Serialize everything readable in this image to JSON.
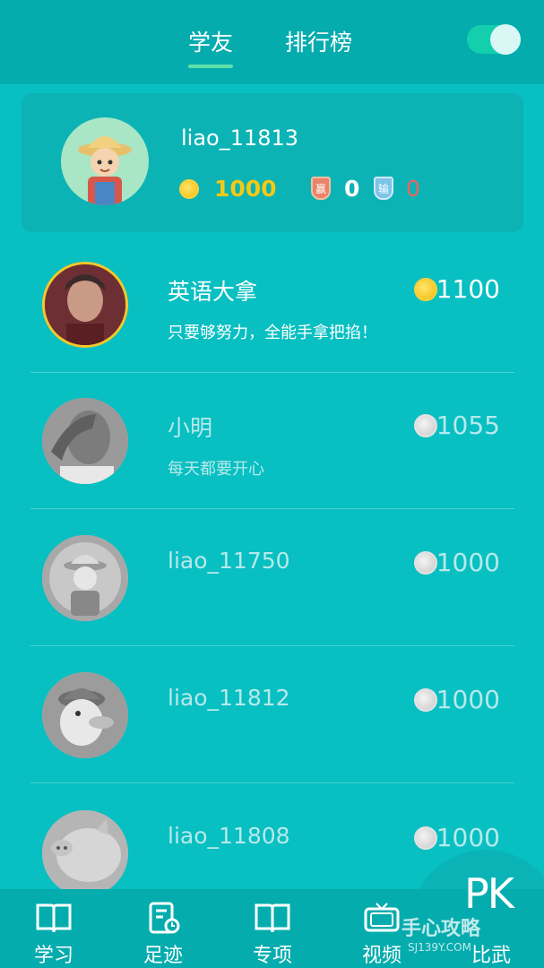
{
  "header": {
    "tabs": [
      {
        "label": "学友",
        "active": true
      },
      {
        "label": "排行榜",
        "active": false
      }
    ],
    "toggle_on": true
  },
  "me": {
    "name": "liao_11813",
    "coins": "1000",
    "wins": "0",
    "losses": "0",
    "win_badge": "赢",
    "lose_badge": "输"
  },
  "friends": [
    {
      "name": "英语大拿",
      "motto": "只要够努力，全能手拿把掐！",
      "score": "1100",
      "coin": "gold"
    },
    {
      "name": "小明",
      "motto": "每天都要开心",
      "score": "1055",
      "coin": "silver"
    },
    {
      "name": "liao_11750",
      "motto": "",
      "score": "1000",
      "coin": "silver"
    },
    {
      "name": "liao_11812",
      "motto": "",
      "score": "1000",
      "coin": "silver"
    },
    {
      "name": "liao_11808",
      "motto": "",
      "score": "1000",
      "coin": "silver"
    }
  ],
  "nav": {
    "items": [
      {
        "label": "学习",
        "icon": "book-icon"
      },
      {
        "label": "足迹",
        "icon": "history-icon"
      },
      {
        "label": "专项",
        "icon": "book-icon"
      },
      {
        "label": "视频",
        "icon": "tv-icon"
      },
      {
        "label": "比武",
        "icon": "pk-icon"
      }
    ],
    "pk_label": "PK"
  },
  "watermark": {
    "text": "手心攻略",
    "sub": "SJ139Y.COM"
  },
  "colors": {
    "background": "#08bfc2",
    "header": "#05acae",
    "gold": "#f6c915",
    "loss": "#ef6363"
  }
}
